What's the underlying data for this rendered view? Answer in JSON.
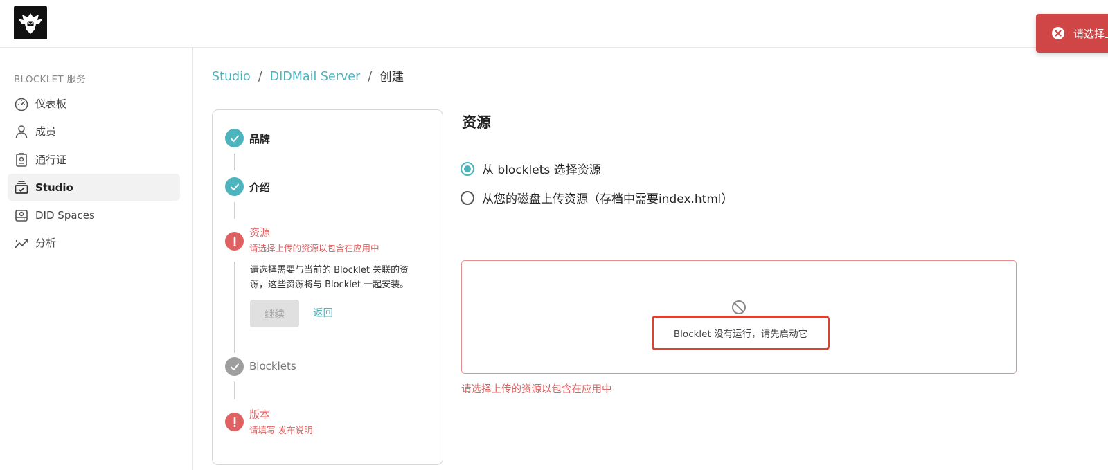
{
  "toast": {
    "message": "请选择上传的资源以包含在应用中",
    "icon": "close-circle-icon",
    "color": "#d04545"
  },
  "sidebar": {
    "section_title": "BLOCKLET 服务",
    "items": [
      {
        "label": "仪表板",
        "icon": "dashboard-icon",
        "active": false
      },
      {
        "label": "成员",
        "icon": "person-icon",
        "active": false
      },
      {
        "label": "通行证",
        "icon": "passport-icon",
        "active": false
      },
      {
        "label": "Studio",
        "icon": "studio-icon",
        "active": true
      },
      {
        "label": "DID Spaces",
        "icon": "storage-icon",
        "active": false
      },
      {
        "label": "分析",
        "icon": "analytics-icon",
        "active": false
      }
    ]
  },
  "breadcrumb": {
    "items": [
      "Studio",
      "DIDMail Server"
    ],
    "current": "创建"
  },
  "stepper": {
    "steps": [
      {
        "label": "品牌",
        "status": "done"
      },
      {
        "label": "介绍",
        "status": "done"
      },
      {
        "label": "资源",
        "status": "error",
        "sub": "请选择上传的资源以包含在应用中"
      },
      {
        "label": "Blocklets",
        "status": "pending"
      },
      {
        "label": "版本",
        "status": "error",
        "sub": "请填写 发布说明"
      }
    ],
    "active_description": "请选择需要与当前的 Blocklet 关联的资源，这些资源将与 Blocklet 一起安装。",
    "continue_label": "继续",
    "back_label": "返回"
  },
  "content": {
    "title": "资源",
    "options": [
      {
        "label": "从 blocklets 选择资源",
        "checked": true
      },
      {
        "label": "从您的磁盘上传资源（存档中需要index.html）",
        "checked": false
      }
    ],
    "status_message": "Blocklet 没有运行，请先启动它",
    "error_text": "请选择上传的资源以包含在应用中"
  },
  "colors": {
    "accent": "#4db3bd",
    "error": "#e06161",
    "toast": "#d04545"
  }
}
